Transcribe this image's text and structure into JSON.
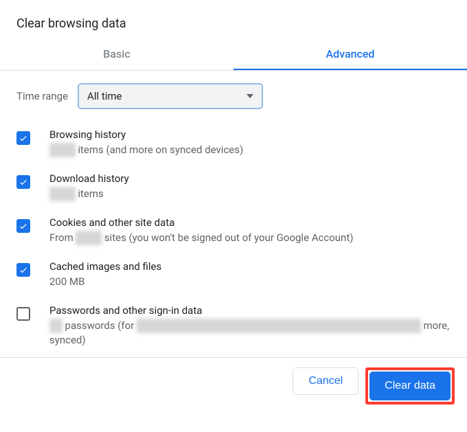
{
  "dialog": {
    "title": "Clear browsing data",
    "tabs": {
      "basic": "Basic",
      "advanced": "Advanced",
      "active": "advanced"
    },
    "time": {
      "label": "Time range",
      "selected": "All time"
    },
    "options": [
      {
        "checked": true,
        "title": "Browsing history",
        "sub_prefix_redacted": "XXXX",
        "sub_suffix": " items (and more on synced devices)"
      },
      {
        "checked": true,
        "title": "Download history",
        "sub_prefix_redacted": "XXXX",
        "sub_suffix": " items"
      },
      {
        "checked": true,
        "title": "Cookies and other site data",
        "sub_prefix": "From ",
        "sub_mid_redacted": "XXXX",
        "sub_suffix": " sites (you won't be signed out of your Google Account)"
      },
      {
        "checked": true,
        "title": "Cached images and files",
        "sub_plain": "200 MB"
      },
      {
        "checked": false,
        "title": "Passwords and other sign-in data",
        "sub_prefix_redacted": "XX",
        "sub_mid": " passwords (for ",
        "sub_mid_redacted": "XXXXXXXXXXXXXXXXXXXXXXXXXXXXXXXXXXXXXXXXXXXX",
        "sub_suffix": " more, synced)"
      }
    ],
    "buttons": {
      "cancel": "Cancel",
      "clear": "Clear data"
    }
  }
}
